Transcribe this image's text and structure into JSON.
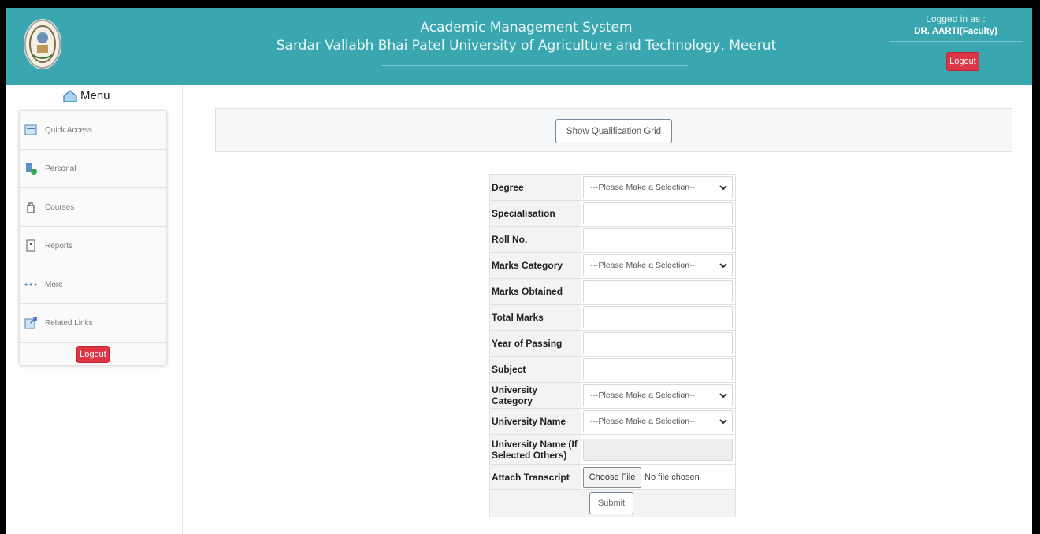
{
  "header": {
    "title_line1": "Academic Management System",
    "title_line2": "Sardar Vallabh Bhai Patel University of Agriculture and Technology, Meerut",
    "logged_in_label": "Logged in as :",
    "user_name": "DR. AARTI(Faculty)",
    "logout_label": "Logout",
    "brand_color": "#3aa7b0"
  },
  "sidebar": {
    "menu_title": "Menu",
    "items": [
      {
        "label": "Quick Access",
        "icon": "quick-access-icon"
      },
      {
        "label": "Personal",
        "icon": "personal-icon"
      },
      {
        "label": "Courses",
        "icon": "courses-icon"
      },
      {
        "label": "Reports",
        "icon": "reports-icon"
      },
      {
        "label": "More",
        "icon": "more-dots-icon"
      },
      {
        "label": "Related Links",
        "icon": "related-links-icon"
      }
    ],
    "logout_label": "Logout"
  },
  "main": {
    "show_grid_label": "Show Qualification Grid",
    "form": {
      "degree_label": "Degree",
      "degree_value": "---Please Make a Selection--",
      "specialisation_label": "Specialisation",
      "roll_label": "Roll No.",
      "marks_category_label": "Marks Category",
      "marks_category_value": "---Please Make a Selection--",
      "marks_obtained_label": "Marks Obtained",
      "total_marks_label": "Total Marks",
      "year_label": "Year of Passing",
      "subject_label": "Subject",
      "univ_category_label": "University Category",
      "univ_category_value": "---Please Make a Selection--",
      "univ_name_label": "University Name",
      "univ_name_value": "---Please Make a Selection--",
      "univ_other_label": "University Name (If Selected Others)",
      "attach_label": "Attach Transcript",
      "choose_file_label": "Choose File",
      "no_file_text": "No file chosen",
      "submit_label": "Submit"
    }
  }
}
